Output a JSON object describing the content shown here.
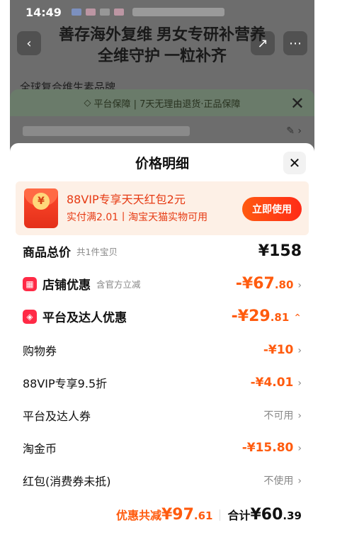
{
  "status_bar": {
    "time": "14:49"
  },
  "background": {
    "title_line1": "善存海外复维 男女专研补营养",
    "title_line2": "全维守护 一粒补齐",
    "subtitle": "全球复合维生素品牌",
    "banner": "平台保障 | 7天无理由退货·正品保障"
  },
  "sheet": {
    "title": "价格明细",
    "promo": {
      "title": "88VIP专享天天红包2元",
      "subtitle": "实付满2.01丨淘宝天猫实物可用",
      "button": "立即使用",
      "coin": "¥"
    },
    "total_goods": {
      "label": "商品总价",
      "hint": "共1件宝贝",
      "amount": "¥158"
    },
    "store_discount": {
      "label": "店铺优惠",
      "hint": "含官方立减",
      "amount_main": "-¥67",
      "amount_dec": ".80"
    },
    "platform_discount": {
      "label": "平台及达人优惠",
      "amount_main": "-¥29",
      "amount_dec": ".81"
    },
    "items": [
      {
        "label": "购物券",
        "value": "-¥10"
      },
      {
        "label": "88VIP专享9.5折",
        "value": "-¥4.01"
      },
      {
        "label": "平台及达人券",
        "value": "不可用"
      },
      {
        "label": "淘金币",
        "value": "-¥15.80"
      },
      {
        "label": "红包(消费券未抵)",
        "value": "不使用"
      }
    ],
    "footer": {
      "save_label": "优惠共减",
      "save_main": "¥97",
      "save_dec": ".61",
      "total_label": "合计",
      "total_main": "¥60",
      "total_dec": ".39"
    }
  },
  "colors": {
    "accent": "#ff5b0e",
    "brand_red": "#e63a13"
  }
}
